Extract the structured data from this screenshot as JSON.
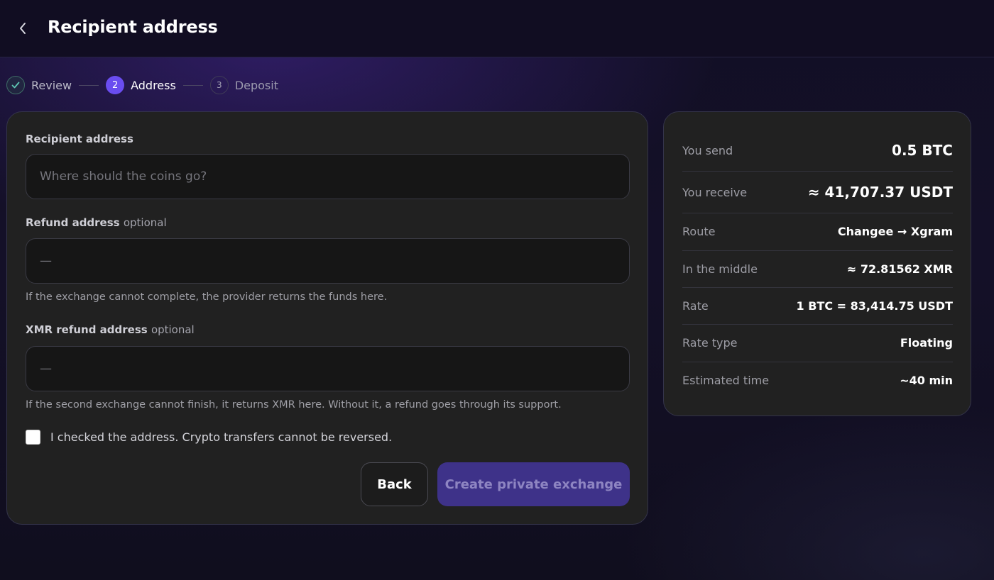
{
  "header": {
    "title": "Recipient address"
  },
  "stepper": {
    "steps": [
      {
        "number": "",
        "label": "Review",
        "state": "done"
      },
      {
        "number": "2",
        "label": "Address",
        "state": "active"
      },
      {
        "number": "3",
        "label": "Deposit",
        "state": "pending"
      }
    ]
  },
  "form": {
    "recipient": {
      "label": "Recipient address",
      "placeholder": "Where should the coins go?",
      "value": ""
    },
    "refund": {
      "label": "Refund address",
      "optional": "optional",
      "placeholder": "—",
      "value": "",
      "hint": "If the exchange cannot complete, the provider returns the funds here."
    },
    "xmr_refund": {
      "label": "XMR refund address",
      "optional": "optional",
      "placeholder": "—",
      "value": "",
      "hint": "If the second exchange cannot finish, it returns XMR here. Without it, a refund goes through its support."
    },
    "confirm_checkbox": {
      "label": "I checked the address. Crypto transfers cannot be reversed.",
      "checked": false
    },
    "buttons": {
      "back": "Back",
      "create": "Create private exchange"
    }
  },
  "summary": {
    "rows": [
      {
        "label": "You send",
        "value": "0.5 BTC"
      },
      {
        "label": "You receive",
        "value": "≈ 41,707.37 USDT"
      },
      {
        "label": "Route",
        "value": "Changee → Xgram"
      },
      {
        "label": "In the middle",
        "value": "≈ 72.81562 XMR"
      },
      {
        "label": "Rate",
        "value": "1 BTC = 83,414.75 USDT"
      },
      {
        "label": "Rate type",
        "value": "Floating"
      },
      {
        "label": "Estimated time",
        "value": "~40 min"
      }
    ]
  },
  "colors": {
    "accent": "#6a4df0",
    "button_primary_disabled": "#3e3289",
    "card_bg": "#212121",
    "page_bg": "#120f25",
    "step_done_check": "#5fc8b4"
  },
  "icons": {
    "back": "chevron-left-icon",
    "step_done": "check-icon"
  }
}
